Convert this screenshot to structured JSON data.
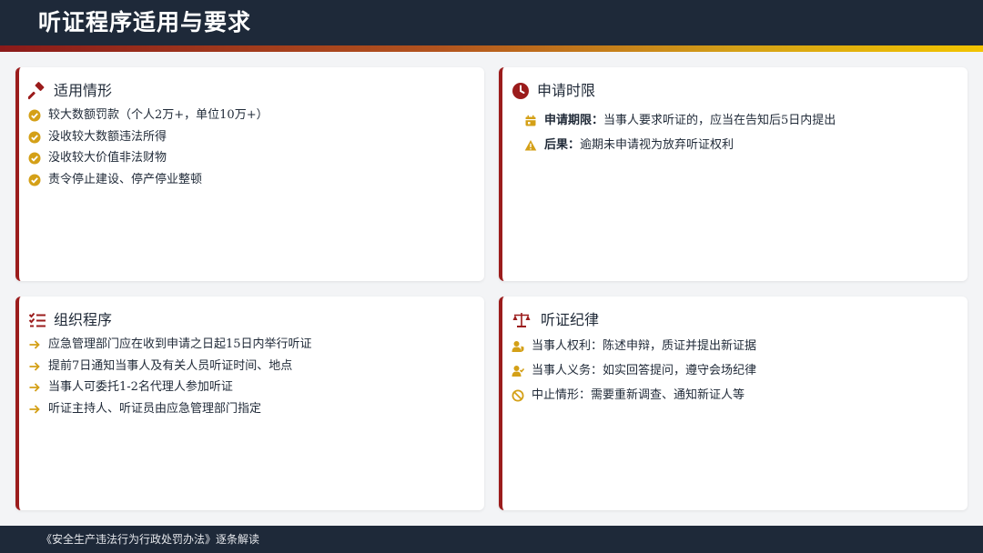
{
  "header": {
    "title": "听证程序适用与要求"
  },
  "colors": {
    "accent_red": "#9b1c1c",
    "accent_gold": "#d4a017",
    "header_bg": "#1e2939"
  },
  "cards": {
    "scope": {
      "title": "适用情形",
      "icon": "gavel-icon",
      "items": [
        {
          "text": "较大数额罚款（个人2万+，单位10万+）",
          "icon": "check-circle-icon"
        },
        {
          "text": "没收较大数额违法所得",
          "icon": "check-circle-icon"
        },
        {
          "text": "没收较大价值非法财物",
          "icon": "check-circle-icon"
        },
        {
          "text": "责令停止建设、停产停业整顿",
          "icon": "check-circle-icon"
        }
      ]
    },
    "deadline": {
      "title": "申请时限",
      "icon": "clock-icon",
      "items": [
        {
          "term": "申请期限：",
          "text": "当事人要求听证的，应当在告知后5日内提出",
          "icon": "calendar-icon"
        },
        {
          "term": "后果：",
          "text": "逾期未申请视为放弃听证权利",
          "icon": "warning-icon"
        }
      ]
    },
    "procedure": {
      "title": "组织程序",
      "icon": "checklist-icon",
      "items": [
        {
          "text": "应急管理部门应在收到申请之日起15日内举行听证",
          "icon": "arrow-right-icon"
        },
        {
          "text": "提前7日通知当事人及有关人员听证时间、地点",
          "icon": "arrow-right-icon"
        },
        {
          "text": "当事人可委托1-2名代理人参加听证",
          "icon": "arrow-right-icon"
        },
        {
          "text": "听证主持人、听证员由应急管理部门指定",
          "icon": "arrow-right-icon"
        }
      ]
    },
    "discipline": {
      "title": "听证纪律",
      "icon": "scale-icon",
      "items": [
        {
          "text": "当事人权利：陈述申辩，质证并提出新证据",
          "icon": "user-shield-icon"
        },
        {
          "text": "当事人义务：如实回答提问，遵守会场纪律",
          "icon": "user-check-icon"
        },
        {
          "text": "中止情形：需要重新调查、通知新证人等",
          "icon": "ban-icon"
        }
      ]
    }
  },
  "footer": {
    "text": "《安全生产违法行为行政处罚办法》逐条解读"
  }
}
